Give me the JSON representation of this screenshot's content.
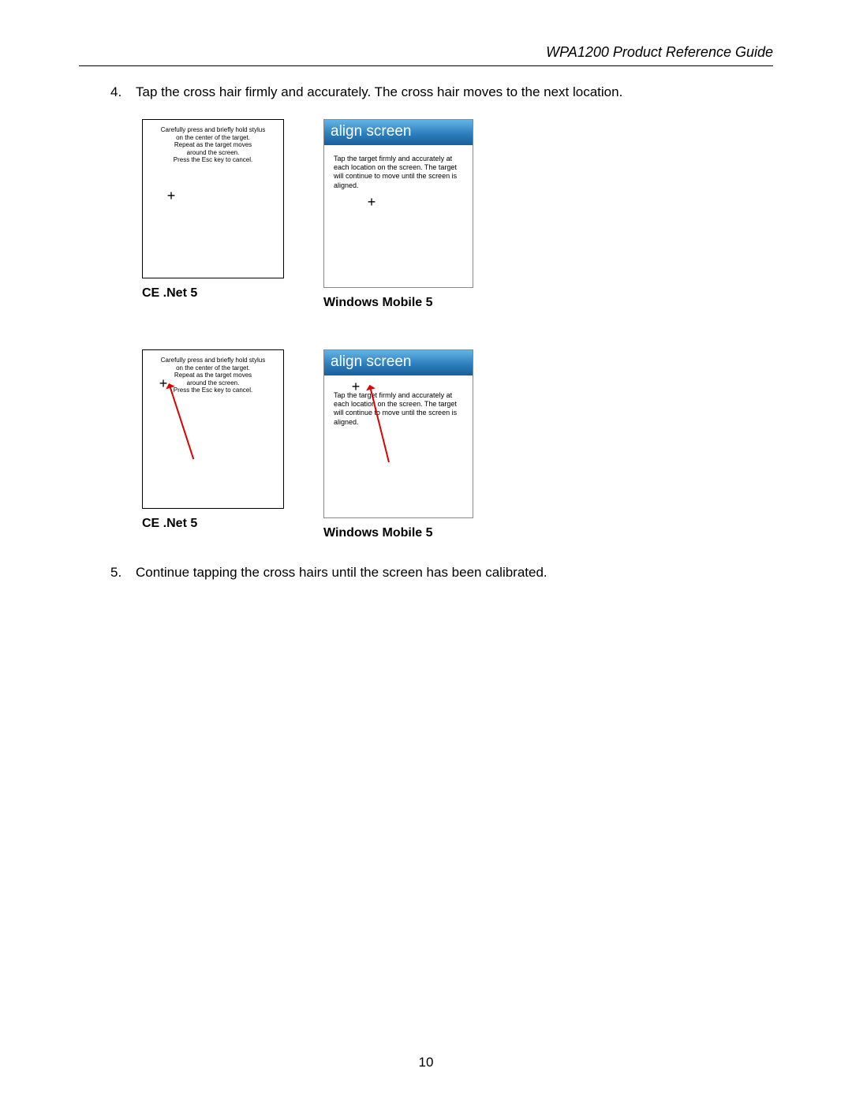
{
  "header": {
    "title": "WPA1200 Product Reference Guide"
  },
  "steps": {
    "s4": {
      "num": "4.",
      "text": "Tap the cross hair firmly and accurately. The cross hair moves to the next location."
    },
    "s5": {
      "num": "5.",
      "text": "Continue tapping the cross hairs until the screen has been calibrated."
    }
  },
  "ce": {
    "instr": "Carefully press and briefly hold stylus\non the center of the target.\nRepeat as the target moves\naround the screen.\nPress the Esc key to cancel.",
    "caption": "CE .Net 5"
  },
  "wm": {
    "banner": "align screen",
    "instr": "Tap the target firmly and accurately at each location on the screen. The target will continue to move until the screen is aligned.",
    "caption": "Windows Mobile 5"
  },
  "glyphs": {
    "cross": "+"
  },
  "pageNumber": "10"
}
